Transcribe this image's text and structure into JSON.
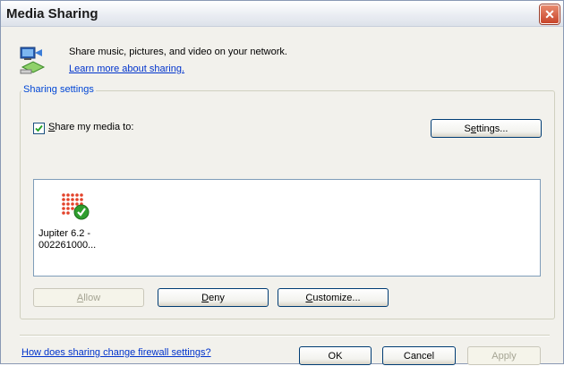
{
  "window": {
    "title": "Media Sharing",
    "close_glyph": "✕"
  },
  "header": {
    "description": "Share music, pictures, and video on your network.",
    "learn_more_link": "Learn more about sharing."
  },
  "sharing_settings": {
    "group_label": "Sharing settings",
    "share_checkbox": {
      "checked": true,
      "label_accel": "S",
      "label_rest": "hare my media to:"
    },
    "settings_button": {
      "pre": "S",
      "accel": "e",
      "post": "ttings..."
    },
    "devices": [
      {
        "line1": "Jupiter 6.2 -",
        "line2": "002261000...",
        "icon": "media-device-shared-icon"
      }
    ],
    "allow_button": {
      "accel": "A",
      "rest": "llow"
    },
    "deny_button": {
      "accel": "D",
      "rest": "eny"
    },
    "customize_button": {
      "accel": "C",
      "rest": "ustomize..."
    }
  },
  "footer": {
    "firewall_link": "How does sharing change firewall settings?",
    "ok_label": "OK",
    "cancel_label": "Cancel",
    "apply_label": "Apply"
  },
  "colors": {
    "link": "#0033cc",
    "group_label": "#0046d5",
    "close_button": "#c8452a"
  }
}
